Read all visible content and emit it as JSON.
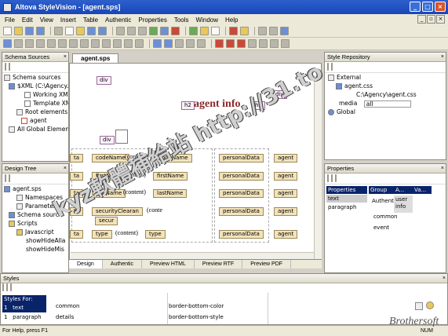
{
  "window": {
    "title": "Altova StyleVision - [agent.sps]"
  },
  "menu": [
    "File",
    "Edit",
    "View",
    "Insert",
    "Table",
    "Authentic",
    "Properties",
    "Tools",
    "Window",
    "Help"
  ],
  "schema_sources": {
    "title": "Schema Sources",
    "items": [
      "Schema sources",
      "$XML (C:\\Agency...)",
      "Working XML",
      "Template XML",
      "Root elements",
      "agent",
      "All Global Elements"
    ]
  },
  "design_tree": {
    "title": "Design Tree",
    "items": [
      "agent.sps",
      "Namespaces",
      "Parameter",
      "Schema sourc",
      "Scripts",
      "Javascript",
      "showHideAlla",
      "showHideMis"
    ]
  },
  "document": {
    "tab": "agent.sps",
    "heading": "agent info",
    "tags": {
      "div": "div",
      "h2": "h2",
      "codeName": "codeName",
      "firstName": "firstName",
      "lastName": "lastName",
      "securityClearance": "securityClearan",
      "secur": "secur",
      "type": "type",
      "personalData": "personalData",
      "agent": "agent",
      "ta": "ta"
    },
    "content": "(content)",
    "cont": "(conte"
  },
  "view_tabs": [
    "Design",
    "Authentic",
    "Preview HTML",
    "Preview RTF",
    "Preview PDF"
  ],
  "style_repository": {
    "title": "Style Repository",
    "items": [
      "External",
      "agent.css",
      "C:\\Agency\\agent.css",
      "media",
      "all",
      "Global"
    ]
  },
  "properties": {
    "title": "Properties",
    "headers": [
      "Properties",
      "Group",
      "A...",
      "Va..."
    ],
    "left_items": [
      "text",
      "paragraph"
    ],
    "groups": [
      "Authenti",
      "common",
      "event"
    ],
    "values": [
      "user",
      "info"
    ]
  },
  "styles": {
    "title": "Styles",
    "styles_for_label": "Styles For:",
    "targets": [
      {
        "count": "1",
        "label": "text"
      },
      {
        "count": "1",
        "label": "paragraph"
      }
    ],
    "groups": [
      "common",
      "details"
    ],
    "properties": [
      "border-bottom-color",
      "border-bottom-style"
    ]
  },
  "status": {
    "text": "For Help, press F1",
    "num": "NUM"
  },
  "watermark": "kyz軟體補給站 http://31.to",
  "brand": "Brothersoft"
}
